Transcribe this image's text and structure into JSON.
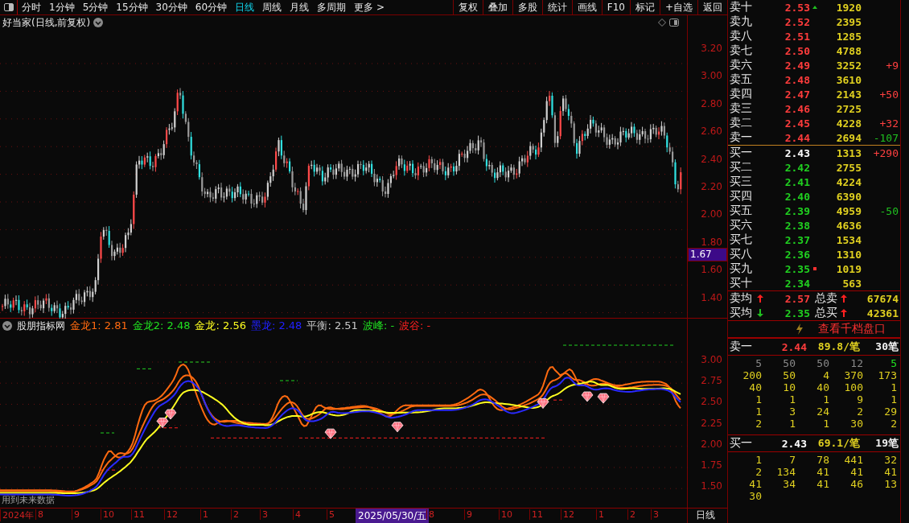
{
  "toolbar": {
    "periods": [
      {
        "label": "分时",
        "selected": false
      },
      {
        "label": "1分钟",
        "selected": false
      },
      {
        "label": "5分钟",
        "selected": false
      },
      {
        "label": "15分钟",
        "selected": false
      },
      {
        "label": "30分钟",
        "selected": false
      },
      {
        "label": "60分钟",
        "selected": false
      },
      {
        "label": "日线",
        "selected": true
      },
      {
        "label": "周线",
        "selected": false
      },
      {
        "label": "月线",
        "selected": false
      },
      {
        "label": "多周期",
        "selected": false
      },
      {
        "label": "更多 >",
        "selected": false
      }
    ],
    "buttons": [
      "复权",
      "叠加",
      "多股",
      "统计",
      "画线",
      "F10",
      "标记",
      "+自选",
      "返回"
    ]
  },
  "main_chart": {
    "title": "好当家(日线,前复权)",
    "y_ticks": [
      "3.20",
      "3.00",
      "2.80",
      "2.60",
      "2.40",
      "2.20",
      "2.00",
      "1.80",
      "1.60",
      "1.40"
    ],
    "price_tag": "1.67"
  },
  "indicator": {
    "name": "股朋指标网",
    "legend": [
      {
        "text": "金龙1: 2.81",
        "color": "#ff6a10"
      },
      {
        "text": "金龙2: 2.48",
        "color": "#20e020"
      },
      {
        "text": "金龙: 2.56",
        "color": "#ffff20"
      },
      {
        "text": "墨龙: 2.48",
        "color": "#2020ff"
      },
      {
        "text": "平衡: 2.51",
        "color": "#c8c8c8"
      },
      {
        "text": "波峰: -",
        "color": "#20e020"
      },
      {
        "text": "波谷: -",
        "color": "#ff2020"
      }
    ],
    "y_ticks": [
      "3.00",
      "2.75",
      "2.50",
      "2.25",
      "2.00",
      "1.75",
      "1.50"
    ],
    "note": "用到未来数据"
  },
  "time_axis": {
    "labels": [
      {
        "text": "2024年",
        "kind": "tick"
      },
      {
        "text": "8",
        "kind": "tick"
      },
      {
        "text": "9",
        "kind": "tick"
      },
      {
        "text": "10",
        "kind": "tick"
      },
      {
        "text": "11",
        "kind": "tick"
      },
      {
        "text": "12",
        "kind": "tick"
      },
      {
        "text": "1",
        "kind": "tick"
      },
      {
        "text": "2",
        "kind": "tick"
      },
      {
        "text": "3",
        "kind": "tick"
      },
      {
        "text": "4",
        "kind": "tick"
      },
      {
        "text": "5",
        "kind": "tick"
      },
      {
        "text": "2025/05/30/五",
        "kind": "cursor"
      },
      {
        "text": "8",
        "kind": "tick"
      },
      {
        "text": "9",
        "kind": "tick"
      },
      {
        "text": "10",
        "kind": "tick"
      },
      {
        "text": "11",
        "kind": "tick"
      },
      {
        "text": "12",
        "kind": "tick"
      },
      {
        "text": "1",
        "kind": "tick"
      },
      {
        "text": "2",
        "kind": "tick"
      },
      {
        "text": "3",
        "kind": "tick"
      }
    ],
    "period": "日线"
  },
  "order_book": {
    "levels": [
      {
        "label": "卖十",
        "price": "2.53",
        "color": "#ff3c3c",
        "marker": {
          "kind": "triangle"
        },
        "volume": "1920"
      },
      {
        "label": "卖九",
        "price": "2.52",
        "color": "#ff3c3c",
        "volume": "2395"
      },
      {
        "label": "卖八",
        "price": "2.51",
        "color": "#ff3c3c",
        "volume": "1285"
      },
      {
        "label": "卖七",
        "price": "2.50",
        "color": "#ff3c3c",
        "volume": "4788"
      },
      {
        "label": "卖六",
        "price": "2.49",
        "color": "#ff3c3c",
        "volume": "3252",
        "change": {
          "text": "+9",
          "color": "#ff4040"
        }
      },
      {
        "label": "卖五",
        "price": "2.48",
        "color": "#ff3c3c",
        "volume": "3610"
      },
      {
        "label": "卖四",
        "price": "2.47",
        "color": "#ff3c3c",
        "volume": "2143",
        "change": {
          "text": "+50",
          "color": "#ff4040"
        }
      },
      {
        "label": "卖三",
        "price": "2.46",
        "color": "#ff3c3c",
        "volume": "2725"
      },
      {
        "label": "卖二",
        "price": "2.45",
        "color": "#ff3c3c",
        "volume": "4228",
        "change": {
          "text": "+32",
          "color": "#ff4040"
        }
      },
      {
        "label": "卖一",
        "price": "2.44",
        "color": "#ff3c3c",
        "volume": "2694",
        "change": {
          "text": "-107",
          "color": "#20c020"
        }
      },
      {
        "label": "买一",
        "price": "2.43",
        "color": "#ffffff",
        "volume": "1313",
        "change": {
          "text": "+290",
          "color": "#ff4040"
        }
      },
      {
        "label": "买二",
        "price": "2.42",
        "color": "#20d020",
        "volume": "2755"
      },
      {
        "label": "买三",
        "price": "2.41",
        "color": "#20d020",
        "volume": "4224"
      },
      {
        "label": "买四",
        "price": "2.40",
        "color": "#20d020",
        "volume": "6390"
      },
      {
        "label": "买五",
        "price": "2.39",
        "color": "#20d020",
        "volume": "4959",
        "change": {
          "text": "-50",
          "color": "#20c020"
        }
      },
      {
        "label": "买六",
        "price": "2.38",
        "color": "#20d020",
        "volume": "4636"
      },
      {
        "label": "买七",
        "price": "2.37",
        "color": "#20d020",
        "volume": "1534"
      },
      {
        "label": "买八",
        "price": "2.36",
        "color": "#20d020",
        "volume": "1310"
      },
      {
        "label": "买九",
        "price": "2.35",
        "color": "#20d020",
        "marker": {
          "kind": "square"
        },
        "volume": "1019"
      },
      {
        "label": "买十",
        "price": "2.34",
        "color": "#20d020",
        "volume": "563"
      }
    ],
    "summary": [
      {
        "label": "卖均",
        "arrow": {
          "kind": "up"
        },
        "price": "2.57",
        "color": "#ff3c3c",
        "total_label": "总卖",
        "total_arrow": {
          "kind": "up"
        },
        "total": "67674"
      },
      {
        "label": "买均",
        "arrow": {
          "kind": "down"
        },
        "price": "2.35",
        "color": "#20d020",
        "total_label": "总买",
        "total_arrow": {
          "kind": "up"
        },
        "total": "42361"
      }
    ],
    "depth_link": "查看千档盘口",
    "queues": [
      {
        "label": "卖一",
        "price": "2.44",
        "color": "#ff3c3c",
        "average": "89.8/笔",
        "count": "30笔",
        "rows": [
          {
            "cells": [
              {
                "text": "5",
                "color": "#8a8a8a"
              },
              {
                "text": "50",
                "color": "#8a8a8a"
              },
              {
                "text": "50",
                "color": "#8a8a8a"
              },
              {
                "text": "12",
                "color": "#8a8a8a"
              },
              {
                "text": "5",
                "color": "#20e020"
              }
            ]
          },
          {
            "cells": [
              {
                "text": "200",
                "color": "#e0d020"
              },
              {
                "text": "50",
                "color": "#e0d020"
              },
              {
                "text": "4",
                "color": "#e0d020"
              },
              {
                "text": "370",
                "color": "#e0d020"
              },
              {
                "text": "173",
                "color": "#e0d020"
              }
            ]
          },
          {
            "cells": [
              {
                "text": "40",
                "color": "#e0d020"
              },
              {
                "text": "10",
                "color": "#e0d020"
              },
              {
                "text": "40",
                "color": "#e0d020"
              },
              {
                "text": "100",
                "color": "#e0d020"
              },
              {
                "text": "1",
                "color": "#e0d020"
              }
            ]
          },
          {
            "cells": [
              {
                "text": "1",
                "color": "#e0d020"
              },
              {
                "text": "1",
                "color": "#e0d020"
              },
              {
                "text": "1",
                "color": "#e0d020"
              },
              {
                "text": "9",
                "color": "#e0d020"
              },
              {
                "text": "1",
                "color": "#e0d020"
              }
            ]
          },
          {
            "cells": [
              {
                "text": "1",
                "color": "#e0d020"
              },
              {
                "text": "3",
                "color": "#e0d020"
              },
              {
                "text": "24",
                "color": "#e0d020"
              },
              {
                "text": "2",
                "color": "#e0d020"
              },
              {
                "text": "29",
                "color": "#e0d020"
              }
            ]
          },
          {
            "cells": [
              {
                "text": "2",
                "color": "#e0d020"
              },
              {
                "text": "1",
                "color": "#e0d020"
              },
              {
                "text": "1",
                "color": "#e0d020"
              },
              {
                "text": "30",
                "color": "#e0d020"
              },
              {
                "text": "2",
                "color": "#e0d020"
              }
            ]
          }
        ]
      },
      {
        "label": "买一",
        "price": "2.43",
        "color": "#ffffff",
        "average": "69.1/笔",
        "count": "19笔",
        "rows": [
          {
            "cells": [
              {
                "text": "1",
                "color": "#e0d020"
              },
              {
                "text": "7",
                "color": "#e0d020"
              },
              {
                "text": "78",
                "color": "#e0d020"
              },
              {
                "text": "441",
                "color": "#e0d020"
              },
              {
                "text": "32",
                "color": "#e0d020"
              }
            ]
          },
          {
            "cells": [
              {
                "text": "2",
                "color": "#e0d020"
              },
              {
                "text": "134",
                "color": "#e0d020"
              },
              {
                "text": "41",
                "color": "#e0d020"
              },
              {
                "text": "41",
                "color": "#e0d020"
              },
              {
                "text": "41",
                "color": "#e0d020"
              }
            ]
          },
          {
            "cells": [
              {
                "text": "41",
                "color": "#e0d020"
              },
              {
                "text": "34",
                "color": "#e0d020"
              },
              {
                "text": "41",
                "color": "#e0d020"
              },
              {
                "text": "46",
                "color": "#e0d020"
              },
              {
                "text": "13",
                "color": "#e0d020"
              }
            ]
          },
          {
            "cells": [
              {
                "text": "30",
                "color": "#e0d020"
              }
            ]
          }
        ]
      }
    ]
  }
}
